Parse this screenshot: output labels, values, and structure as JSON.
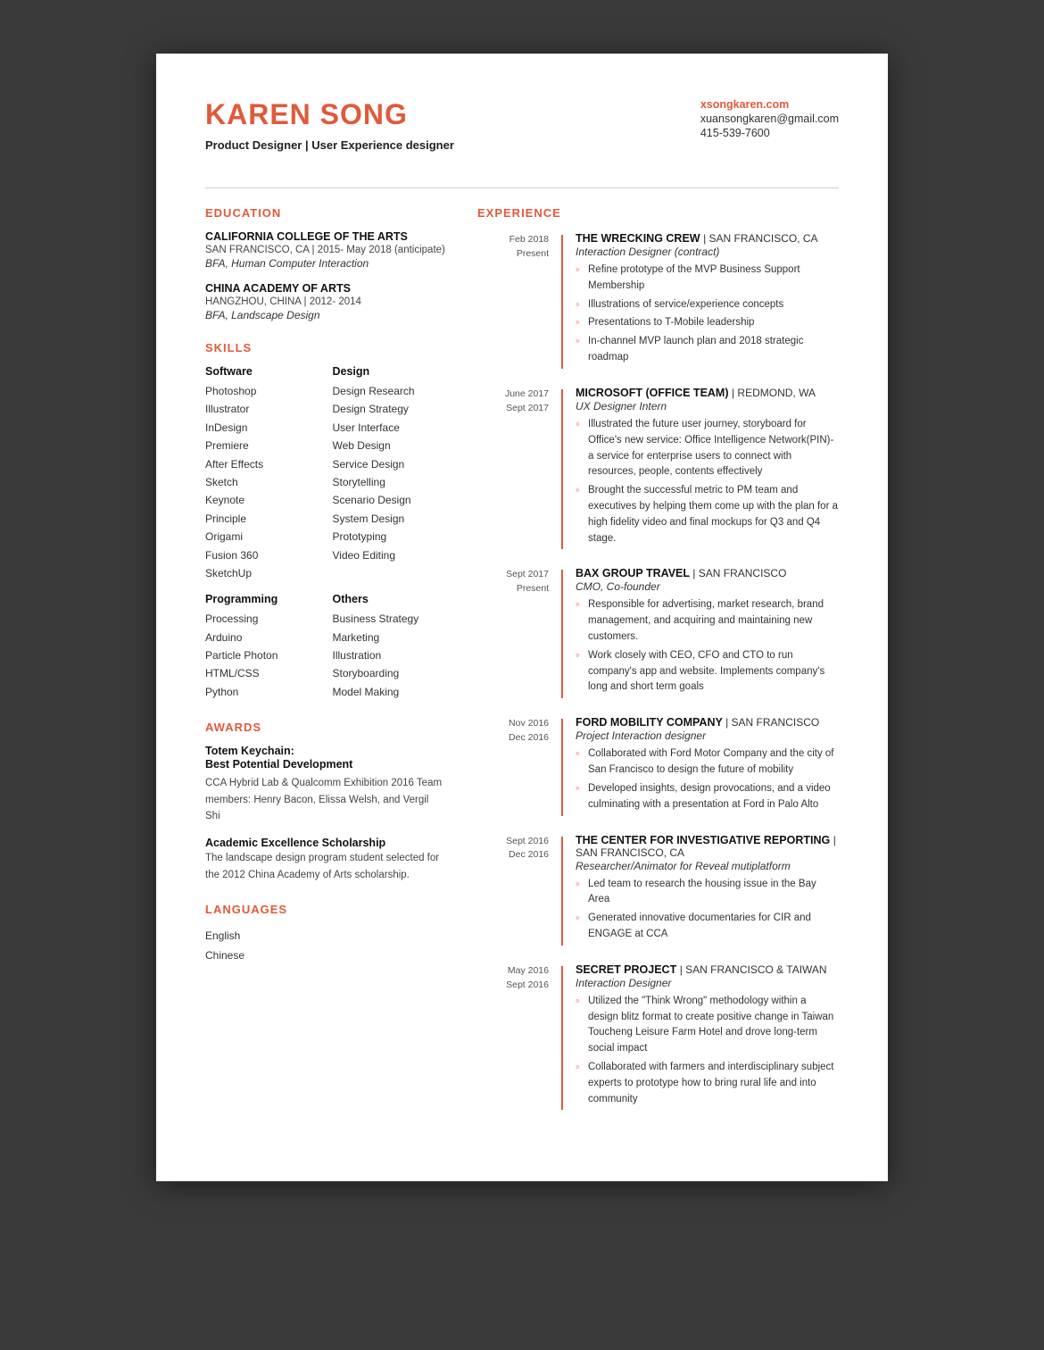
{
  "header": {
    "name": "KAREN SONG",
    "subtitle": "Product Designer | User Experience designer",
    "website": "xsongkaren.com",
    "email": "xuansongkaren@gmail.com",
    "phone": "415-539-7600"
  },
  "education": {
    "heading": "EDUCATION",
    "schools": [
      {
        "name": "CALIFORNIA COLLEGE OF THE ARTS",
        "location": "SAN FRANCISCO, CA  |  2015- May 2018 (anticipate)",
        "degree": "BFA, Human Computer Interaction"
      },
      {
        "name": "CHINA ACADEMY OF ARTS",
        "location": "HANGZHOU, CHINA  |  2012- 2014",
        "degree": "BFA, Landscape Design"
      }
    ]
  },
  "skills": {
    "heading": "SKILLS",
    "software": {
      "heading": "Software",
      "items": [
        "Photoshop",
        "Illustrator",
        "InDesign",
        "Premiere",
        "After Effects",
        "Sketch",
        "Keynote",
        "Principle",
        "Origami",
        "Fusion 360",
        "SketchUp"
      ]
    },
    "design": {
      "heading": "Design",
      "items": [
        "Design Research",
        "Design Strategy",
        "User Interface",
        "Web Design",
        "Service Design",
        "Storytelling",
        "Scenario Design",
        "System Design",
        "Prototyping",
        "Video Editing"
      ]
    },
    "programming": {
      "heading": "Programming",
      "items": [
        "Processing",
        "Arduino",
        "Particle Photon",
        "HTML/CSS",
        "Python"
      ]
    },
    "others": {
      "heading": "Others",
      "items": [
        "Business Strategy",
        "Marketing",
        "Illustration",
        "Storyboarding",
        "Model Making"
      ]
    }
  },
  "awards": {
    "heading": "AWARDS",
    "list": [
      {
        "title": "Totem Keychain:",
        "subtitle": "Best Potential Development",
        "desc": "CCA Hybrid Lab & Qualcomm Exhibition 2016\nTeam members:\nHenry Bacon, Elissa Welsh, and Vergil Shi"
      },
      {
        "title": "Academic Excellence Scholarship",
        "subtitle": "",
        "desc": "The landscape design program student selected for the 2012 China Academy of Arts scholarship."
      }
    ]
  },
  "languages": {
    "heading": "LANGUAGES",
    "items": [
      "English",
      "Chinese"
    ]
  },
  "experience": {
    "heading": "EXPERIENCE",
    "entries": [
      {
        "date_start": "Feb 2018",
        "date_end": "Present",
        "company": "THE WRECKING CREW",
        "location": "SAN FRANCISCO, CA",
        "role": "Interaction Designer (contract)",
        "bullets": [
          "Refine prototype of the MVP Business Support Membership",
          "Illustrations of service/experience concepts",
          "Presentations to T-Mobile leadership",
          "In-channel MVP launch plan and 2018 strategic roadmap"
        ]
      },
      {
        "date_start": "June 2017",
        "date_end": "Sept 2017",
        "company": "MICROSOFT (Office team)",
        "location": "REDMOND, WA",
        "role": "UX Designer Intern",
        "bullets": [
          "Illustrated the future user journey, storyboard for Office's new service: Office Intelligence Network(PIN)- a service for enterprise users to connect with resources, people, contents effectively",
          "Brought the successful metric to PM team and executives by helping them come up with the plan for a high fidelity video and final mockups for Q3 and Q4 stage."
        ]
      },
      {
        "date_start": "Sept 2017",
        "date_end": "Present",
        "company": "BAX Group Travel",
        "location": "SAN FRANCISCO",
        "role": "CMO, Co-founder",
        "bullets": [
          "Responsible for advertising, market research, brand management, and acquiring and maintaining new customers.",
          "Work closely with CEO, CFO and CTO to run company's app and website. Implements company's long and short term goals"
        ]
      },
      {
        "date_start": "Nov 2016",
        "date_end": "Dec 2016",
        "company": "FORD MOBILITY COMPANY",
        "location": "SAN FRANCISCO",
        "role": "Project Interaction designer",
        "bullets": [
          "Collaborated with Ford Motor Company and the city of San Francisco to design the future of mobility",
          "Developed insights, design provocations, and a video culminating with a presentation at Ford in Palo Alto"
        ]
      },
      {
        "date_start": "Sept 2016",
        "date_end": "Dec 2016",
        "company": "THE CENTER FOR INVESTIGATIVE REPORTING",
        "location": "SAN FRANCISCO, CA",
        "role": "Researcher/Animator for Reveal mutiplatform",
        "bullets": [
          "Led team to research the housing issue in the Bay Area",
          "Generated innovative documentaries for CIR and ENGAGE at CCA"
        ]
      },
      {
        "date_start": "May 2016",
        "date_end": "Sept 2016",
        "company": "SECRET PROJECT",
        "location": "SAN FRANCISCO & TAIWAN",
        "role": "Interaction Designer",
        "bullets": [
          "Utilized the \"Think Wrong\" methodology within a design blitz format to create positive change in Taiwan Toucheng Leisure Farm Hotel and drove long-term social impact",
          "Collaborated with farmers and interdisciplinary subject experts  to prototype how to bring rural life and into community"
        ]
      }
    ]
  }
}
